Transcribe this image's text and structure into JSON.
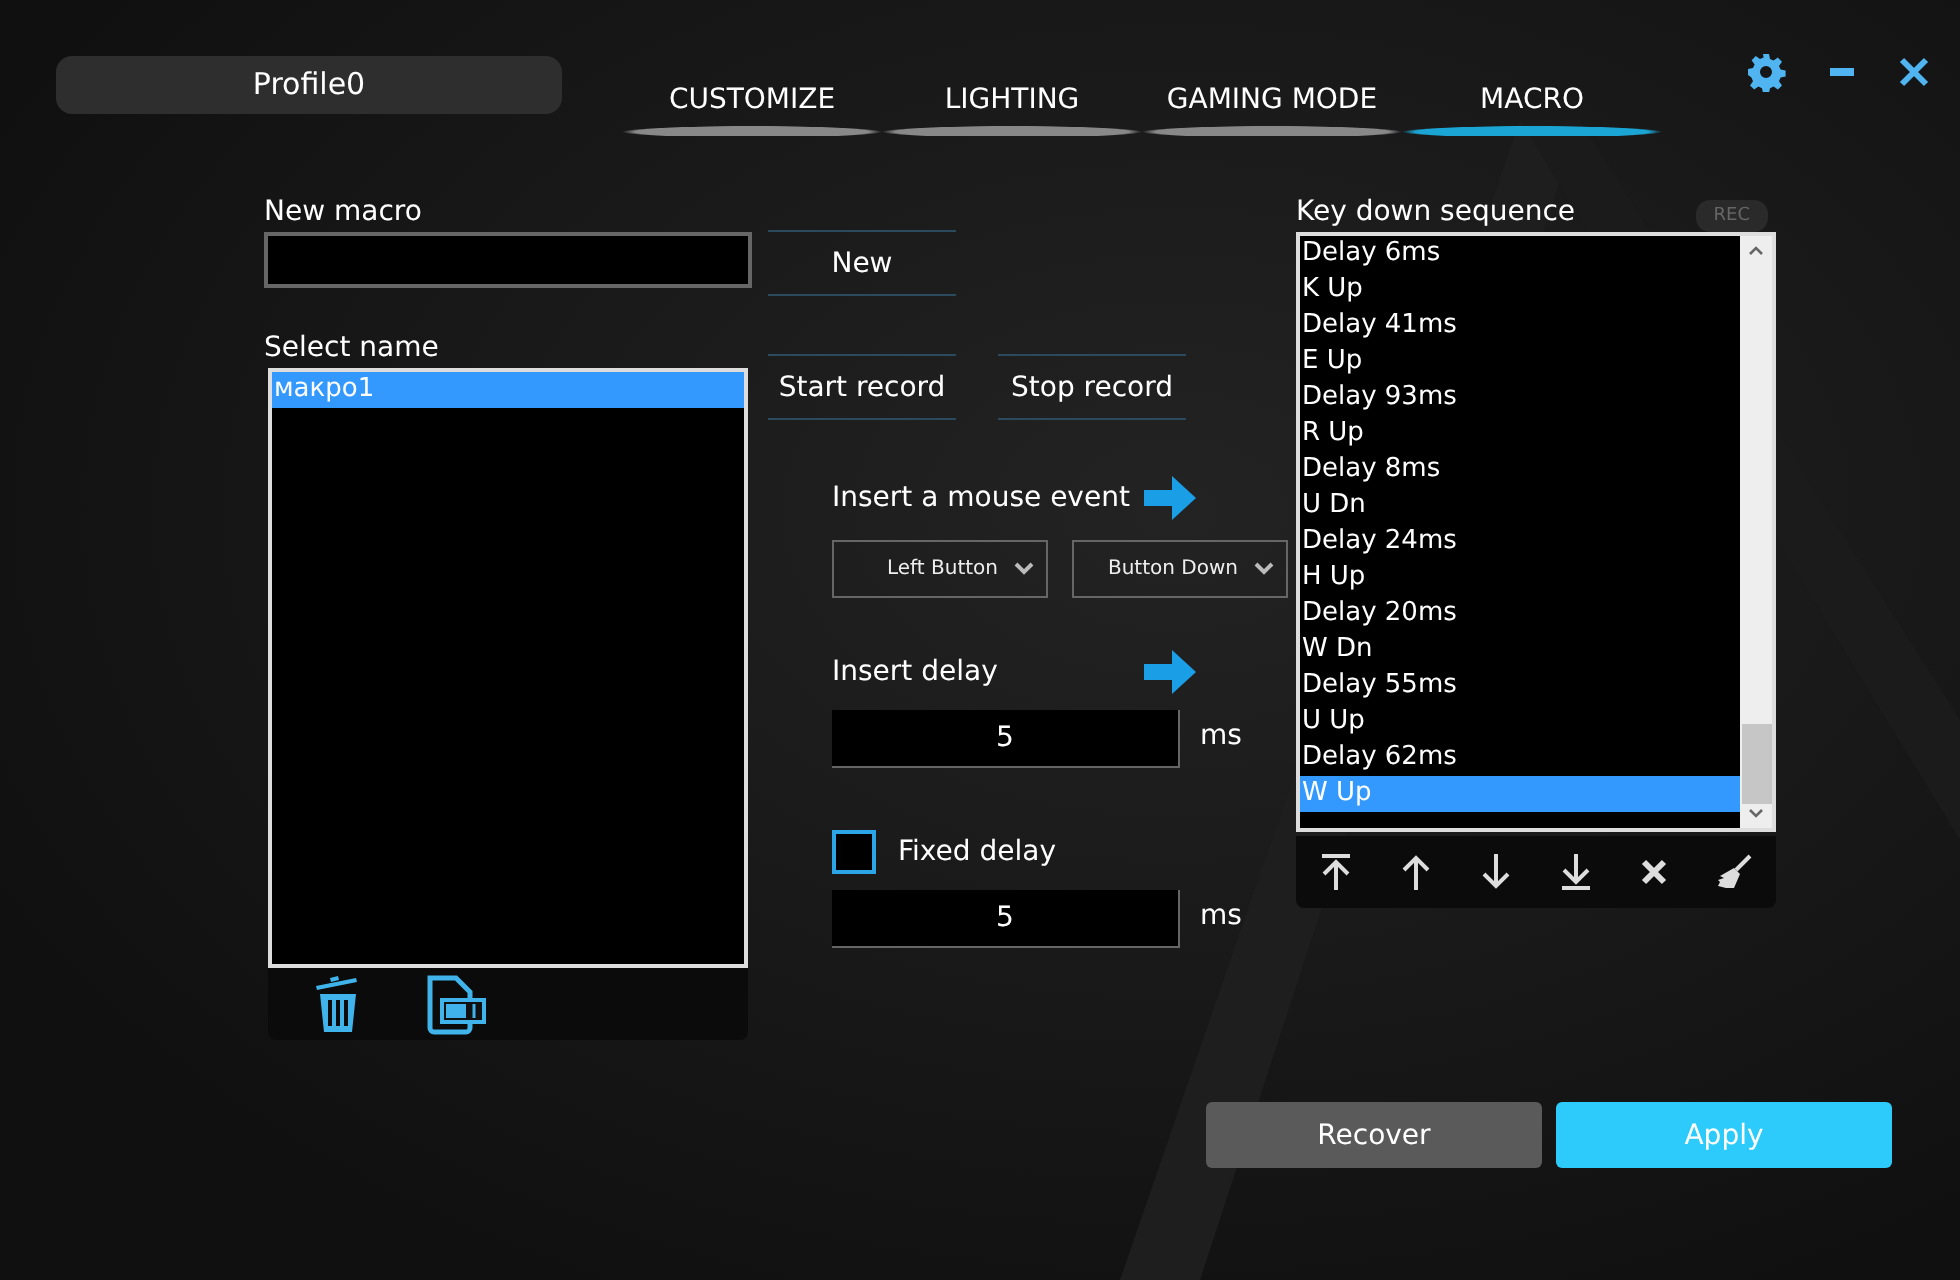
{
  "profile": "Profile0",
  "tabs": [
    {
      "label": "CUSTOMIZE",
      "selected": false
    },
    {
      "label": "LIGHTING",
      "selected": false
    },
    {
      "label": "GAMING MODE",
      "selected": false
    },
    {
      "label": "MACRO",
      "selected": true
    }
  ],
  "new_macro": {
    "label": "New macro",
    "button": "New"
  },
  "select_name": {
    "label": "Select name",
    "items": [
      {
        "label": "макро1",
        "selected": true
      }
    ]
  },
  "record_buttons": [
    "Start record",
    "Stop record"
  ],
  "mouse_event": {
    "label": "Insert a mouse event",
    "button_value": "Left Button",
    "action_value": "Button Down"
  },
  "insert_delay": {
    "label": "Insert delay",
    "value": "5",
    "unit": "ms"
  },
  "fixed_delay": {
    "label": "Fixed delay",
    "checked": false,
    "value": "5",
    "unit": "ms"
  },
  "sequence": {
    "label": "Key down sequence",
    "rec": "REC",
    "items": [
      {
        "label": "Delay 6ms",
        "selected": false
      },
      {
        "label": "K Up",
        "selected": false
      },
      {
        "label": "Delay 41ms",
        "selected": false
      },
      {
        "label": "E Up",
        "selected": false
      },
      {
        "label": "Delay 93ms",
        "selected": false
      },
      {
        "label": "R Up",
        "selected": false
      },
      {
        "label": "Delay 8ms",
        "selected": false
      },
      {
        "label": "U Dn",
        "selected": false
      },
      {
        "label": "Delay 24ms",
        "selected": false
      },
      {
        "label": "H Up",
        "selected": false
      },
      {
        "label": "Delay 20ms",
        "selected": false
      },
      {
        "label": "W Dn",
        "selected": false
      },
      {
        "label": "Delay 55ms",
        "selected": false
      },
      {
        "label": "U Up",
        "selected": false
      },
      {
        "label": "Delay 62ms",
        "selected": false
      },
      {
        "label": "W Up",
        "selected": true
      }
    ]
  },
  "footer_buttons": [
    "Recover",
    "Apply"
  ]
}
